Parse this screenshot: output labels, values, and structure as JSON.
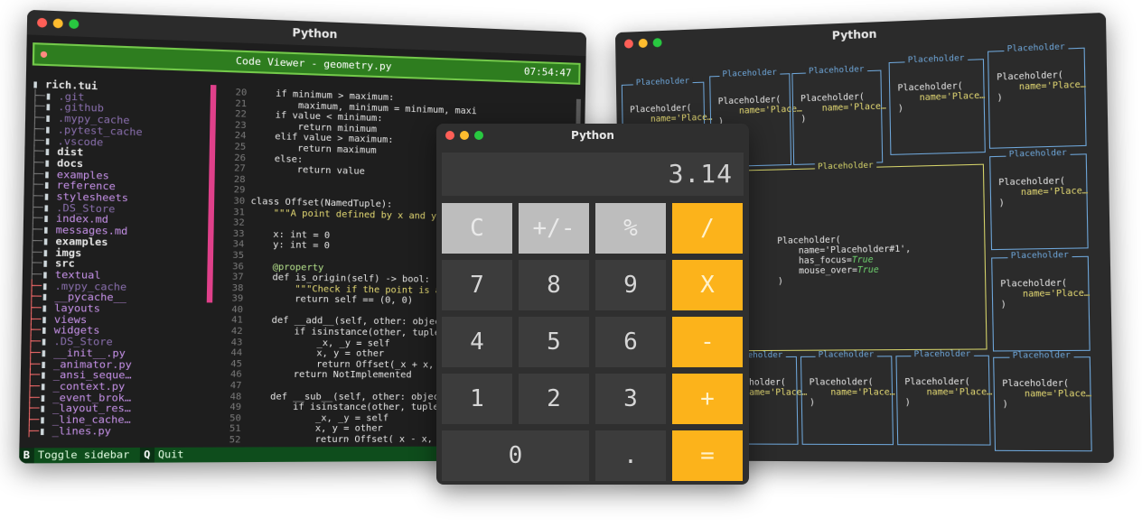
{
  "left_window": {
    "title": "Python",
    "header_title": "Code Viewer - geometry.py",
    "clock": "07:54:47",
    "tree": [
      {
        "t": "rich.tui",
        "c": "dir",
        "d": 0
      },
      {
        "t": ".git",
        "c": "hid",
        "d": 1
      },
      {
        "t": ".github",
        "c": "hid",
        "d": 1
      },
      {
        "t": ".mypy_cache",
        "c": "hid",
        "d": 1
      },
      {
        "t": ".pytest_cache",
        "c": "hid",
        "d": 1
      },
      {
        "t": ".vscode",
        "c": "hid",
        "d": 1
      },
      {
        "t": "dist",
        "c": "dir",
        "d": 1
      },
      {
        "t": "docs",
        "c": "dir",
        "d": 1
      },
      {
        "t": "examples",
        "c": "file",
        "d": 2
      },
      {
        "t": "reference",
        "c": "file",
        "d": 2
      },
      {
        "t": "stylesheets",
        "c": "file",
        "d": 2
      },
      {
        "t": ".DS_Store",
        "c": "hid",
        "d": 2
      },
      {
        "t": "index.md",
        "c": "file",
        "d": 2
      },
      {
        "t": "messages.md",
        "c": "file",
        "d": 2
      },
      {
        "t": "examples",
        "c": "dir",
        "d": 1
      },
      {
        "t": "imgs",
        "c": "dir",
        "d": 1
      },
      {
        "t": "src",
        "c": "dir",
        "d": 1
      },
      {
        "t": "textual",
        "c": "file",
        "d": 2
      },
      {
        "t": ".mypy_cache",
        "c": "hid",
        "d": 3
      },
      {
        "t": "__pycache__",
        "c": "file",
        "d": 3
      },
      {
        "t": "layouts",
        "c": "file",
        "d": 3
      },
      {
        "t": "views",
        "c": "file",
        "d": 3
      },
      {
        "t": "widgets",
        "c": "file",
        "d": 3
      },
      {
        "t": ".DS_Store",
        "c": "hid",
        "d": 3
      },
      {
        "t": "__init__.py",
        "c": "file",
        "d": 3
      },
      {
        "t": "_animator.py",
        "c": "file",
        "d": 3
      },
      {
        "t": "_ansi_seque…",
        "c": "file",
        "d": 3
      },
      {
        "t": "_context.py",
        "c": "file",
        "d": 3
      },
      {
        "t": "_event_brok…",
        "c": "file",
        "d": 3
      },
      {
        "t": "_layout_res…",
        "c": "file",
        "d": 3
      },
      {
        "t": "_line_cache…",
        "c": "file",
        "d": 3
      },
      {
        "t": "_lines.py",
        "c": "file",
        "d": 3
      }
    ],
    "line_numbers": [
      "20",
      "21",
      "22",
      "23",
      "24",
      "25",
      "26",
      "27",
      "28",
      "29",
      "30",
      "31",
      "32",
      "33",
      "34",
      "35",
      "36",
      "37",
      "38",
      "39",
      "40",
      "41",
      "42",
      "43",
      "44",
      "45",
      "46",
      "47",
      "48",
      "49",
      "50",
      "51",
      "52"
    ],
    "code_lines": [
      "    if minimum > maximum:",
      "        maximum, minimum = minimum, maxi",
      "    if value < minimum:",
      "        return minimum",
      "    elif value > maximum:",
      "        return maximum",
      "    else:",
      "        return value",
      "",
      "",
      "class Offset(NamedTuple):",
      "    \"\"\"A point defined by x and y co",
      "",
      "    x: int = 0",
      "    y: int = 0",
      "",
      "    @property",
      "    def is_origin(self) -> bool:",
      "        \"\"\"Check if the point is at",
      "        return self == (0, 0)",
      "",
      "    def __add__(self, other: object)",
      "        if isinstance(other, tuple):",
      "            _x, _y = self",
      "            x, y = other",
      "            return Offset(_x + x, _y",
      "        return NotImplemented",
      "",
      "    def __sub__(self, other: object)",
      "        if isinstance(other, tuple):",
      "            _x, _y = self",
      "            x, y = other",
      "            return Offset(_x - x, _y"
    ],
    "footer": {
      "key1": "B",
      "label1": "Toggle sidebar",
      "key2": "Q",
      "label2": "Quit"
    }
  },
  "calculator": {
    "title": "Python",
    "display": "3.14",
    "keys": [
      {
        "label": "C",
        "style": "light"
      },
      {
        "label": "+/-",
        "style": "light"
      },
      {
        "label": "%",
        "style": "light"
      },
      {
        "label": "/",
        "style": "op"
      },
      {
        "label": "7",
        "style": "dark"
      },
      {
        "label": "8",
        "style": "dark"
      },
      {
        "label": "9",
        "style": "dark"
      },
      {
        "label": "X",
        "style": "op"
      },
      {
        "label": "4",
        "style": "dark"
      },
      {
        "label": "5",
        "style": "dark"
      },
      {
        "label": "6",
        "style": "dark"
      },
      {
        "label": "-",
        "style": "op"
      },
      {
        "label": "1",
        "style": "dark"
      },
      {
        "label": "2",
        "style": "dark"
      },
      {
        "label": "3",
        "style": "dark"
      },
      {
        "label": "+",
        "style": "op"
      },
      {
        "label": "0",
        "style": "dark"
      },
      {
        "label": ".",
        "style": "dark"
      },
      {
        "label": "=",
        "style": "op"
      }
    ]
  },
  "right_window": {
    "title": "Python",
    "placeholders": {
      "label": "Placeholder",
      "small_text_1": "Placeholder(",
      "small_text_2": "    name='Place…",
      "small_text_3": ")",
      "big": {
        "line1": "Placeholder(",
        "line2": "    name='Placeholder#1',",
        "line3a": "    has_focus=",
        "line3b": "True",
        "line4a": "    mouse_over=",
        "line4b": "True",
        "line5": ")"
      }
    }
  },
  "colors": {
    "accent_green": "#2e7d1f",
    "operator": "#fcb31b",
    "placeholder_blue": "#6fa8dc",
    "focus_yellow": "#d7d56a"
  }
}
